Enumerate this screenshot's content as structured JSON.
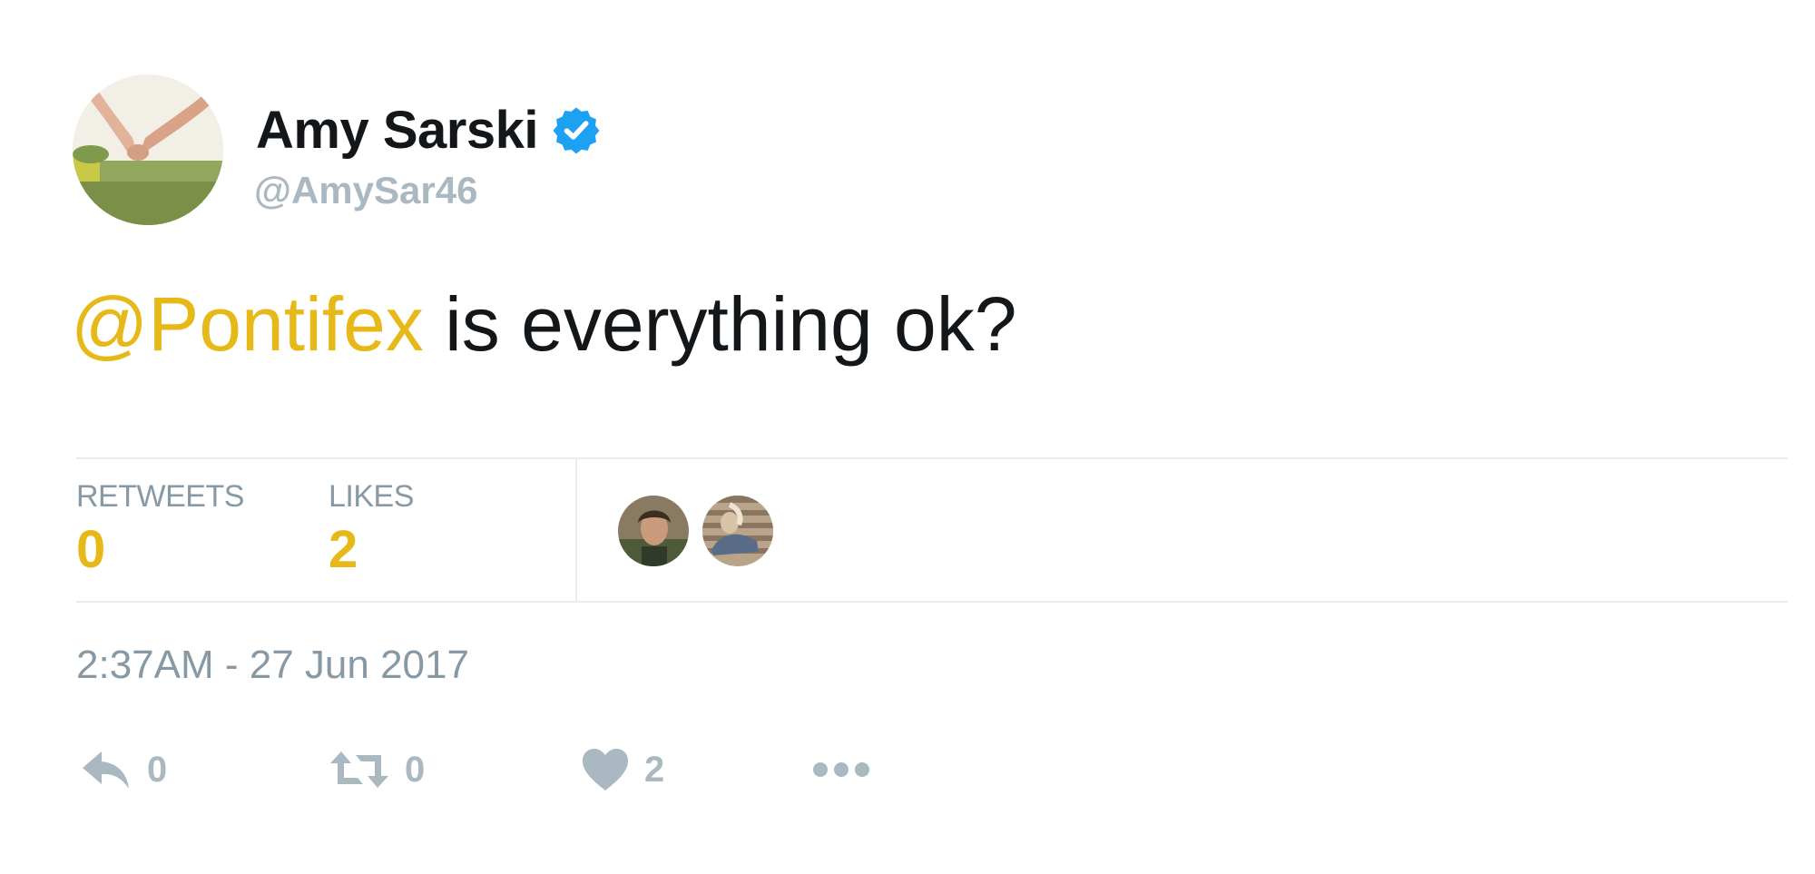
{
  "user": {
    "display_name": "Amy Sarski",
    "handle": "@AmySar46",
    "verified": true
  },
  "tweet": {
    "mention": "@Pontifex",
    "text": " is everything ok?"
  },
  "stats": {
    "retweets_label": "RETWEETS",
    "retweets_value": "0",
    "likes_label": "LIKES",
    "likes_value": "2"
  },
  "timestamp": "2:37AM - 27 Jun 2017",
  "actions": {
    "reply_count": "0",
    "retweet_count": "0",
    "like_count": "2"
  },
  "icons": {
    "verified": "verified-badge-icon",
    "reply": "reply-icon",
    "retweet": "retweet-icon",
    "like": "heart-icon",
    "more": "more-dots-icon"
  },
  "colors": {
    "accent": "#e6b919",
    "verified": "#1da1f2",
    "muted": "#8899a6",
    "icon": "#aab8c2",
    "text": "#14171a"
  }
}
